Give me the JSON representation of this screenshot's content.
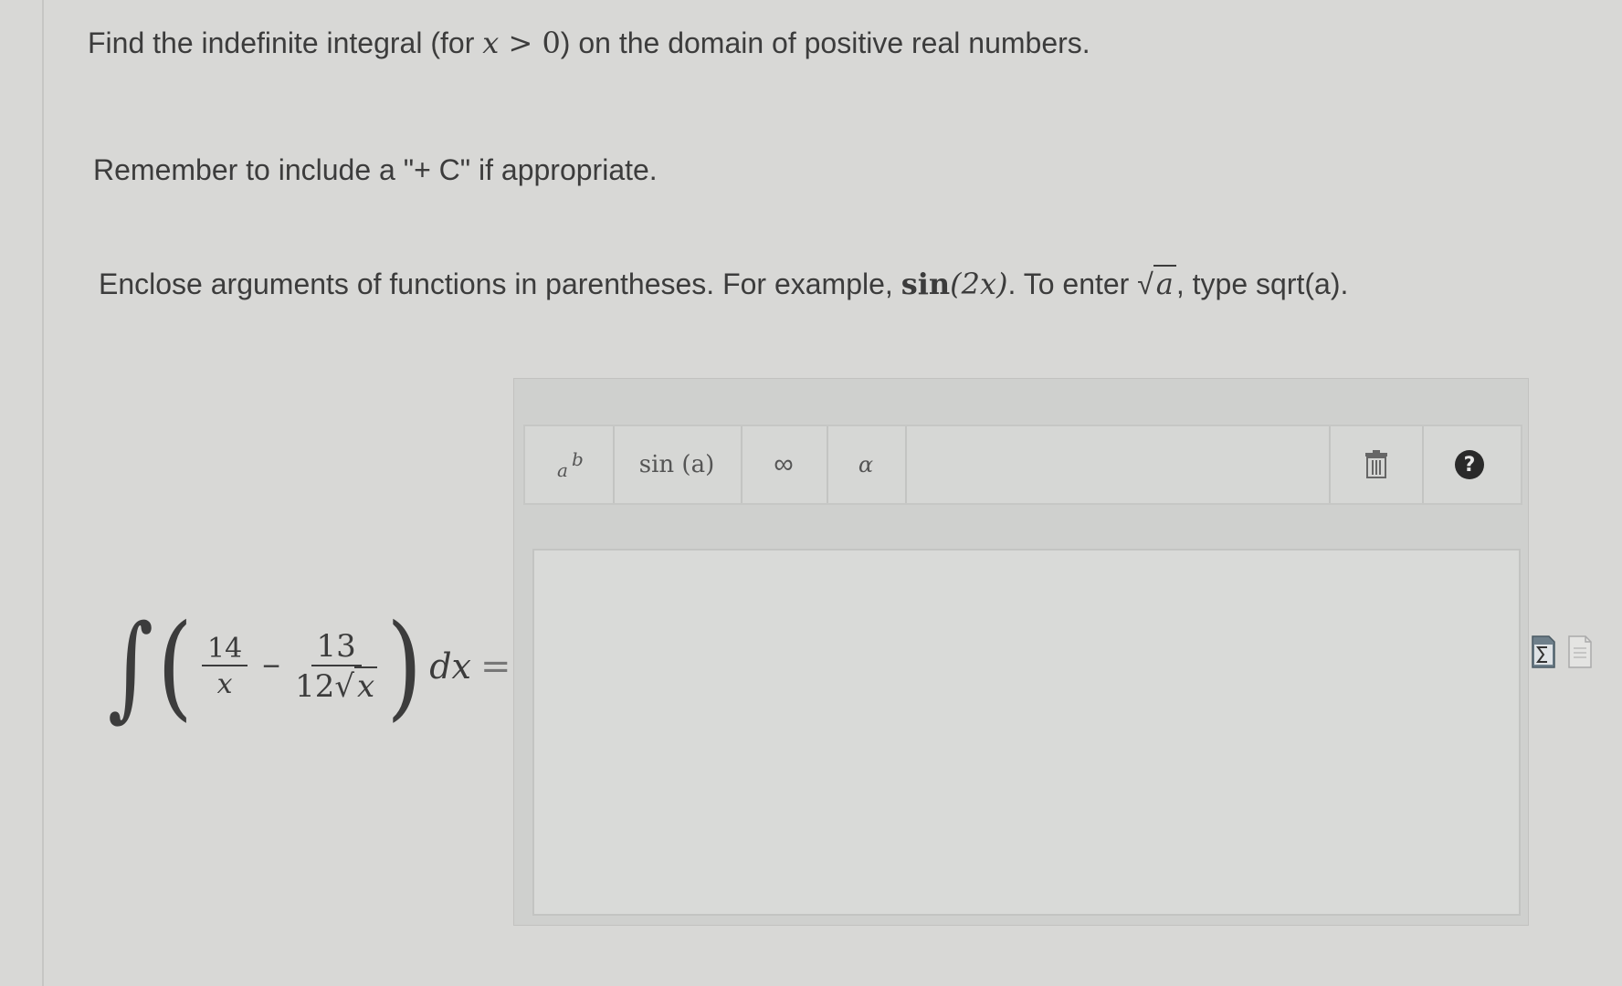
{
  "instructions": {
    "line1_pre": "Find the indefinite integral (for ",
    "line1_var": "x",
    "line1_op": " > 0",
    "line1_post": ") on the domain of positive real numbers.",
    "line2": "Remember to include a \"+ C\" if appropriate.",
    "line3_pre": "Enclose arguments of functions in parentheses. For example, ",
    "line3_example_fn": "sin",
    "line3_example_arg": "(2x)",
    "line3_mid": ". To enter ",
    "line3_sqrt_arg": "a",
    "line3_post": ", type sqrt(a)."
  },
  "problem": {
    "integral_sign": "∫",
    "open_paren": "(",
    "frac1_num": "14",
    "frac1_den": "x",
    "minus": "−",
    "frac2_num": "13",
    "frac2_den_coef": "12",
    "frac2_den_sqrt_arg": "x",
    "close_paren": ")",
    "dx": "dx",
    "equals": "="
  },
  "toolbar": {
    "power_base": "a",
    "power_exp": "b",
    "sin_label": "sin (a)",
    "infinity_label": "∞",
    "alpha_label": "α",
    "help_label": "?"
  },
  "answer": {
    "value": ""
  },
  "icons": {
    "power": "superscript-icon",
    "trash": "trash-icon",
    "help": "help-icon",
    "sigma": "sigma-icon",
    "doc": "document-icon"
  }
}
